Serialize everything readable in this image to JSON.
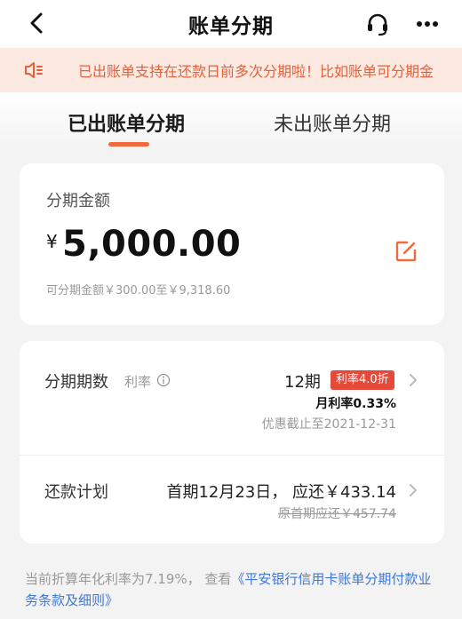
{
  "nav": {
    "title": "账单分期",
    "icons": [
      "back-arrow-icon",
      "headset-icon",
      "more-icon"
    ]
  },
  "notice": {
    "text": "已出账单支持在还款日前多次分期啦！比如账单可分期金"
  },
  "tabs": [
    {
      "label": "已出账单分期",
      "active": true
    },
    {
      "label": "未出账单分期",
      "active": false
    }
  ],
  "amount_card": {
    "label": "分期金额",
    "currency": "¥",
    "amount": "5,000.00",
    "range": "可分期金额￥300.00至￥9,318.60"
  },
  "term_row": {
    "label": "分期期数",
    "rate_label": "利率",
    "value": "12期",
    "badge": "利率4.0折",
    "monthly_rate": "月利率0.33%",
    "promo_end": "优惠截止至2021-12-31"
  },
  "plan_row": {
    "label": "还款计划",
    "value": "首期12月23日， 应还￥433.14",
    "original": "原首期应还￥457.74"
  },
  "footer": {
    "text": "当前折算年化利率为7.19%，  查看",
    "link": "《平安银行信用卡账单分期付款业务条款及细则》"
  },
  "colors": {
    "accent": "#f26a3c",
    "notice_bg": "#fce9e2",
    "notice_text": "#e3623a",
    "badge": "#e4493a",
    "link": "#3c78d8"
  }
}
